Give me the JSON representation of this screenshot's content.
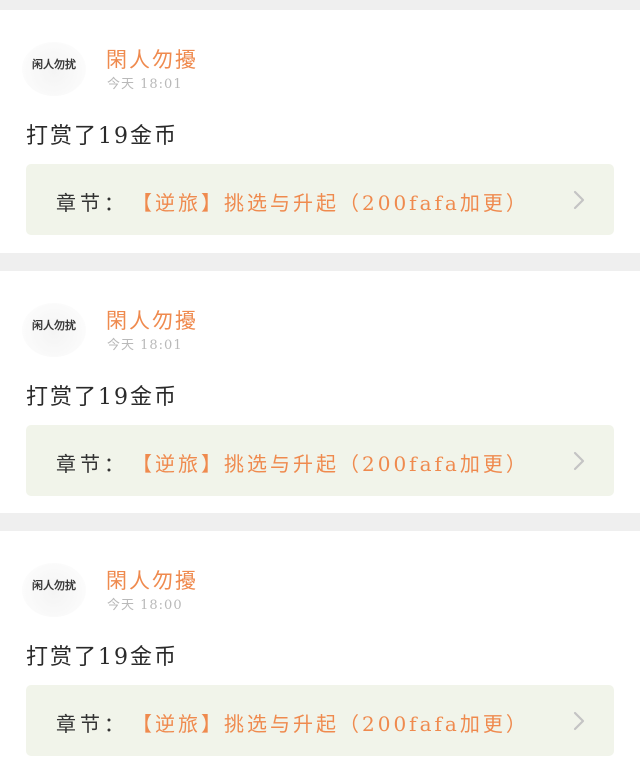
{
  "feed": {
    "items": [
      {
        "avatar_text": "闲人勿扰",
        "username": "閑人勿擾",
        "time": "今天 18:01",
        "message": "打赏了19金币",
        "chapter_prefix": "章节：",
        "chapter_title": "【逆旅】挑选与升起（200fafa加更）"
      },
      {
        "avatar_text": "闲人勿扰",
        "username": "閑人勿擾",
        "time": "今天 18:01",
        "message": "打赏了19金币",
        "chapter_prefix": "章节：",
        "chapter_title": "【逆旅】挑选与升起（200fafa加更）"
      },
      {
        "avatar_text": "闲人勿扰",
        "username": "閑人勿擾",
        "time": "今天 18:00",
        "message": "打赏了19金币",
        "chapter_prefix": "章节：",
        "chapter_title": "【逆旅】挑选与升起（200fafa加更）"
      }
    ],
    "icons": {
      "chevron": "chevron-right-icon"
    }
  },
  "colors": {
    "accent": "#ef8a4e",
    "chapter_bg": "#f1f4ea",
    "page_bg": "#efefef",
    "time_gray": "#b9b9b9"
  }
}
